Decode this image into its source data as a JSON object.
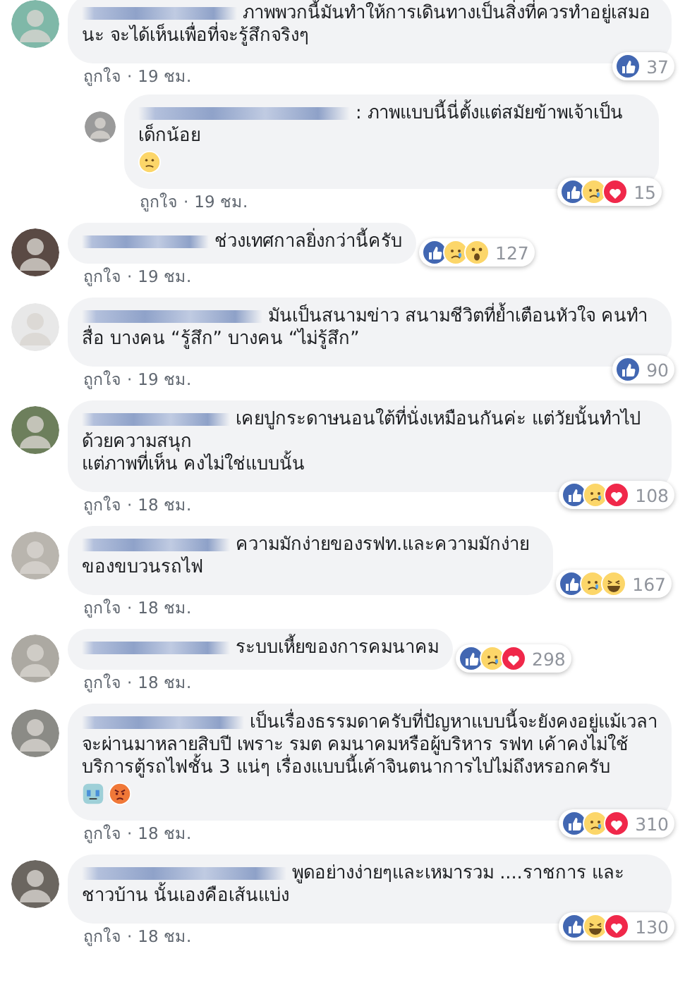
{
  "comments": [
    {
      "text": "ภาพพวกนี้มันทำให้การเดินทางเป็นสิ่งที่ควรทำอยู่เสมอนะ จะได้เห็นเพื่อที่จะรู้สึกจริงๆ",
      "reactions": [
        {
          "kind": "like"
        }
      ],
      "count": "37",
      "like_label": "ถูกใจ",
      "separator": "·",
      "time": "19 ชม.",
      "children": [
        {
          "text": ": ภาพแบบนี้นี่ตั้งแต่สมัยข้าพเจ้าเป็นเด็กน้อย",
          "emoji": [
            {
              "kind": "confused"
            }
          ],
          "reactions": [
            {
              "kind": "like"
            },
            {
              "kind": "sad"
            },
            {
              "kind": "love"
            }
          ],
          "count": "15",
          "like_label": "ถูกใจ",
          "separator": "·",
          "time": "19 ชม."
        }
      ]
    },
    {
      "text": "ช่วงเทศกาลยิ่งกว่านี้ครับ",
      "reactions": [
        {
          "kind": "like"
        },
        {
          "kind": "sad"
        },
        {
          "kind": "wow"
        }
      ],
      "count": "127",
      "like_label": "ถูกใจ",
      "separator": "·",
      "time": "19 ชม."
    },
    {
      "text": "มันเป็นสนามข่าว สนามชีวิตที่ย้ำเตือนหัวใจ คนทำสื่อ บางคน “รู้สึก” บางคน “ไม่รู้สึก”",
      "reactions": [
        {
          "kind": "like"
        }
      ],
      "count": "90",
      "like_label": "ถูกใจ",
      "separator": "·",
      "time": "19 ชม."
    },
    {
      "text": "เคยปูกระดาษนอนใต้ที่นั่งเหมือนกันค่ะ แต่วัยนั้นทำไปด้วยความสนุก\nแต่ภาพที่เห็น คงไม่ใช่แบบนั้น",
      "reactions": [
        {
          "kind": "like"
        },
        {
          "kind": "sad"
        },
        {
          "kind": "love"
        }
      ],
      "count": "108",
      "like_label": "ถูกใจ",
      "separator": "·",
      "time": "18 ชม."
    },
    {
      "text": "ความมักง่ายของรฟท.และความมักง่ายของขบวนรถไฟ",
      "reactions": [
        {
          "kind": "like"
        },
        {
          "kind": "sad"
        },
        {
          "kind": "haha"
        }
      ],
      "count": "167",
      "like_label": "ถูกใจ",
      "separator": "·",
      "time": "18 ชม."
    },
    {
      "text": "ระบบเหี้ยของการคมนาคม",
      "reactions": [
        {
          "kind": "like"
        },
        {
          "kind": "sad"
        },
        {
          "kind": "love"
        }
      ],
      "count": "298",
      "like_label": "ถูกใจ",
      "separator": "·",
      "time": "18 ชม."
    },
    {
      "text": "เป็นเรื่องธรรมดาครับที่ปัญหาแบบนี้จะยังคงอยู่แม้เวลาจะผ่านมาหลายสิบปี เพราะ รมต คมนาคมหรือผู้บริหาร รฟท เค้าคงไม่ใช้บริการตู้รถไฟชั้น 3 แน่ๆ เรื่องแบบนี้เค้าจินตนาการไปไม่ถึงหรอกครับ",
      "emoji": [
        {
          "kind": "crying"
        },
        {
          "kind": "angry"
        }
      ],
      "reactions": [
        {
          "kind": "like"
        },
        {
          "kind": "sad"
        },
        {
          "kind": "love"
        }
      ],
      "count": "310",
      "like_label": "ถูกใจ",
      "separator": "·",
      "time": "18 ชม."
    },
    {
      "text": "พูดอย่างง่ายๆและเหมารวม ....ราชการ และ ชาวบ้าน นั้นเองคือเส้นแบ่ง",
      "reactions": [
        {
          "kind": "like"
        },
        {
          "kind": "haha"
        },
        {
          "kind": "love"
        }
      ],
      "count": "130",
      "like_label": "ถูกใจ",
      "separator": "·",
      "time": "18 ชม."
    }
  ]
}
